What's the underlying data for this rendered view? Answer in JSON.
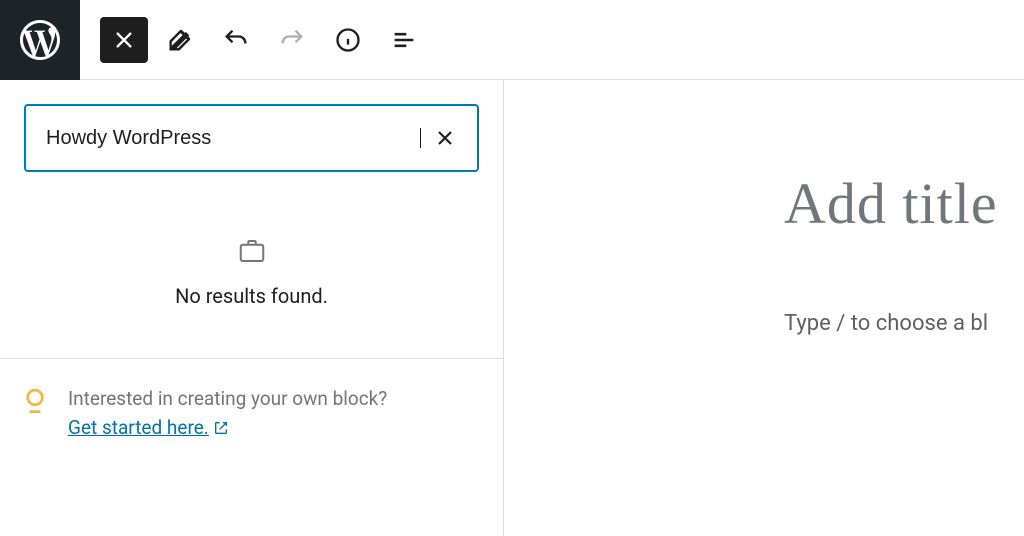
{
  "search": {
    "value": "Howdy WordPress",
    "no_results_text": "No results found."
  },
  "tip": {
    "text": "Interested in creating your own block?",
    "link_text": "Get started here."
  },
  "editor": {
    "title_placeholder": "Add title",
    "body_placeholder": "Type / to choose a bl"
  }
}
